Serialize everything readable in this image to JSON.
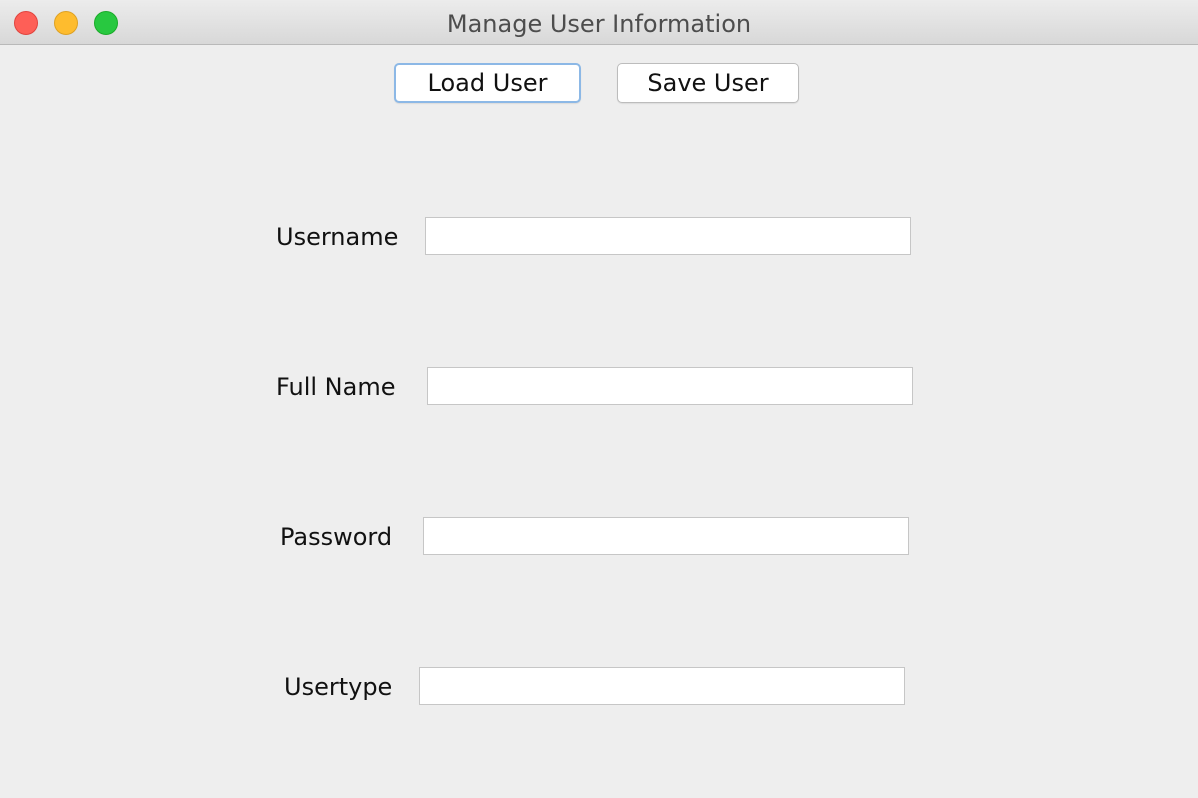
{
  "window": {
    "title": "Manage User Information"
  },
  "toolbar": {
    "load_label": "Load User",
    "save_label": "Save User"
  },
  "form": {
    "username": {
      "label": "Username",
      "value": "",
      "placeholder": ""
    },
    "full_name": {
      "label": "Full Name",
      "value": "",
      "placeholder": ""
    },
    "password": {
      "label": "Password",
      "value": "",
      "placeholder": ""
    },
    "usertype": {
      "label": "Usertype",
      "value": "",
      "placeholder": ""
    }
  },
  "colors": {
    "close": "#fe5f57",
    "minimize": "#febc2e",
    "zoom": "#28c840",
    "focus_ring": "#8cb8e6",
    "background": "#eeeeee"
  }
}
